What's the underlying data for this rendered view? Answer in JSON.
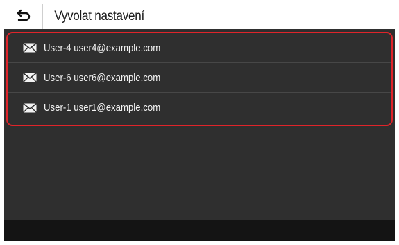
{
  "header": {
    "back_icon": "back-arrow-icon",
    "title": "Vyvolat nastavení"
  },
  "list": {
    "item_icon": "envelope-icon",
    "items": [
      {
        "label": "User-4 user4@example.com"
      },
      {
        "label": "User-6 user6@example.com"
      },
      {
        "label": "User-1 user1@example.com"
      }
    ]
  },
  "colors": {
    "highlight_border": "#e0242a",
    "list_background": "#2f2f2f",
    "footer_background": "#141414"
  }
}
